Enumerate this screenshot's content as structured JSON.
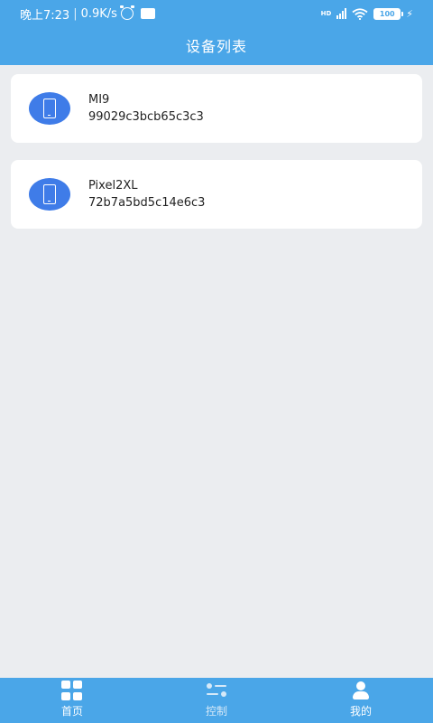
{
  "status_bar": {
    "time": "晚上7:23",
    "separator": "|",
    "net_speed": "0.9K/s",
    "network_badge": "HD",
    "battery": "100",
    "icons": [
      "alarm-icon",
      "notification-icon",
      "signal-icon",
      "wifi-icon",
      "battery-icon",
      "charging-icon"
    ]
  },
  "header": {
    "title": "设备列表"
  },
  "devices": [
    {
      "name": "MI9",
      "id": "99029c3bcb65c3c3",
      "icon": "phone-icon"
    },
    {
      "name": "Pixel2XL",
      "id": "72b7a5bd5c14e6c3",
      "icon": "phone-icon"
    }
  ],
  "bottom_nav": [
    {
      "label": "首页",
      "icon": "grid-icon",
      "active": true
    },
    {
      "label": "控制",
      "icon": "sliders-icon",
      "active": false
    },
    {
      "label": "我的",
      "icon": "user-icon",
      "active": true
    }
  ],
  "colors": {
    "primary": "#4aa6e8",
    "device_icon": "#3f7ce8",
    "background": "#ebedf0",
    "card": "#ffffff"
  }
}
